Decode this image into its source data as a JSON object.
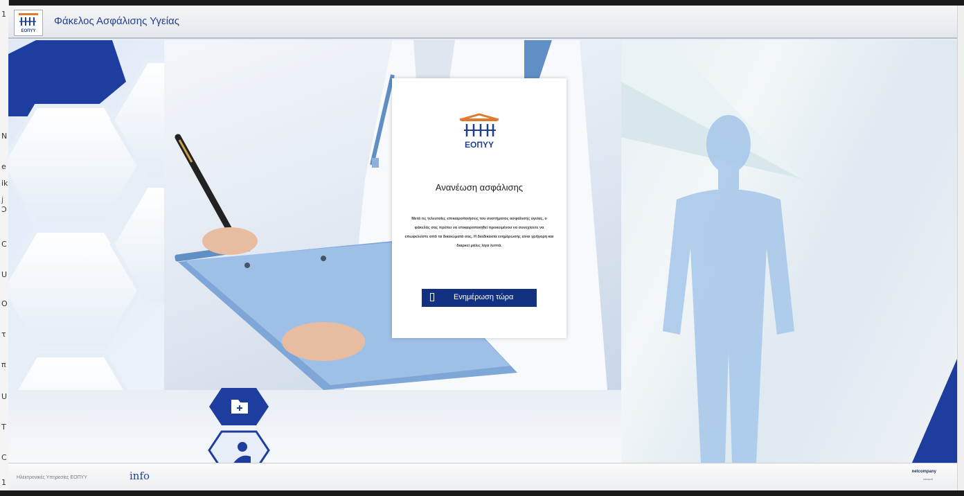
{
  "app": {
    "title": "Φάκελος Ασφάλισης Υγείας",
    "logo_text": "ΕΟΠΥΥ"
  },
  "left_strip": {
    "chars": [
      "1",
      "N",
      "e",
      "ik",
      "j",
      "Ͻ",
      "C",
      "U",
      "O",
      "τ",
      "π",
      "U",
      "T",
      "C",
      "1"
    ]
  },
  "card": {
    "logo_text": "ΕΟΠΥΥ",
    "title": "Ανανέωση ασφάλισης",
    "body": "Μετά τις τελευταίες επικαιροποιήσεις του συστήματος ασφάλισης υγείας, ο φάκελός σας πρέπει να επικαιροποιηθεί προκειμένου να συνεχίσετε να επωφελείστε από τα δικαιώματά σας. Η διαδικασία ενημέρωσης είναι γρήγορη και διαρκεί μόλις λίγα λεπτά.",
    "button_label": "Ενημέρωση τώρα"
  },
  "footer": {
    "org": "Ηλεκτρονικές Υπηρεσίες ΕΟΠΥΥ",
    "info": "info",
    "vendor": "netcompany",
    "vendor_sub": "intrasoft"
  },
  "icons": {
    "folder": "folder-plus-icon",
    "doctor": "doctor-icon"
  },
  "colors": {
    "brand_blue": "#123180",
    "title_blue": "#1f3f8f",
    "accent_orange": "#e07a2e"
  }
}
